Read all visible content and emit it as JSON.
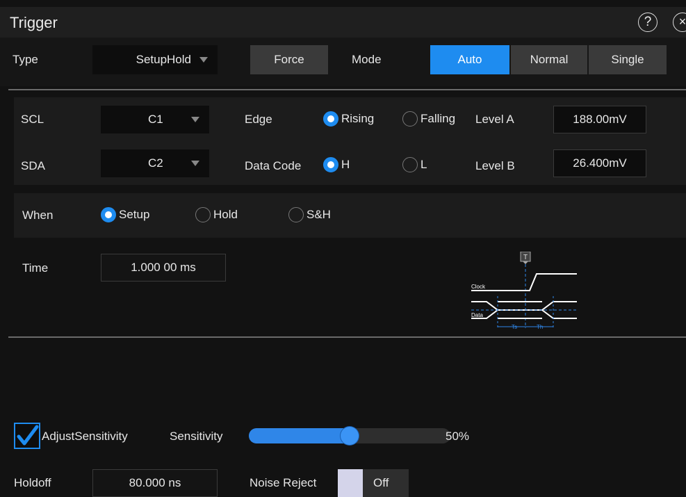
{
  "window": {
    "title": "Trigger",
    "help_symbol": "?",
    "close_symbol": "×"
  },
  "top": {
    "type_label": "Type",
    "type_value": "SetupHold",
    "force_label": "Force",
    "mode_label": "Mode",
    "modes": [
      "Auto",
      "Normal",
      "Single"
    ],
    "active_mode": "Auto"
  },
  "sources": {
    "scl_label": "SCL",
    "scl_value": "C1",
    "sda_label": "SDA",
    "sda_value": "C2",
    "edge_label": "Edge",
    "edge_options": [
      "Rising",
      "Falling"
    ],
    "edge_selected": "Rising",
    "datacode_label": "Data Code",
    "datacode_options": [
      "H",
      "L"
    ],
    "datacode_selected": "H",
    "level_a_label": "Level A",
    "level_a_value": "188.00mV",
    "level_b_label": "Level B",
    "level_b_value": "26.400mV"
  },
  "when": {
    "label": "When",
    "options": [
      "Setup",
      "Hold",
      "S&H"
    ],
    "selected": "Setup"
  },
  "time": {
    "label": "Time",
    "value": "1.000 00 ms"
  },
  "diagram": {
    "trigger_marker": "T",
    "clock_label": "Clock",
    "data_label": "Data",
    "ts_label": "Ts",
    "th_label": "Th"
  },
  "sensitivity": {
    "adjust_label": "AdjustSensitivity",
    "adjust_checked": true,
    "label": "Sensitivity",
    "value_percent": 50,
    "value_text": "50%"
  },
  "holdoff": {
    "label": "Holdoff",
    "value": "80.000 ns"
  },
  "noise_reject": {
    "label": "Noise Reject",
    "state": "Off"
  },
  "colors": {
    "accent": "#1e8cf0",
    "background": "#121212",
    "panel": "#1c1c1c"
  }
}
